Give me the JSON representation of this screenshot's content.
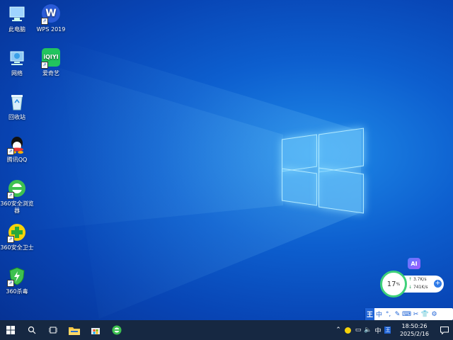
{
  "desktop": {
    "icons": [
      {
        "label": "此电脑",
        "icon": "computer-icon"
      },
      {
        "label": "WPS 2019",
        "icon": "wps-icon"
      },
      {
        "label": "网络",
        "icon": "network-icon"
      },
      {
        "label": "爱奇艺",
        "icon": "iqiyi-icon"
      },
      {
        "label": "回收站",
        "icon": "recycle-bin-icon"
      },
      {
        "label": "腾讯QQ",
        "icon": "qq-icon"
      },
      {
        "label": "360安全浏览器",
        "icon": "360-browser-icon"
      },
      {
        "label": "360安全卫士",
        "icon": "360-guard-icon"
      },
      {
        "label": "360杀毒",
        "icon": "360-antivirus-icon"
      }
    ],
    "iqiyi_logo_text": "iQIYI",
    "wps_logo_text": "W"
  },
  "widget": {
    "ai_label": "AI",
    "cpu_percent": "17",
    "percent_sign": "%",
    "upload": "3.7K/s",
    "download": "741K/s"
  },
  "ime": {
    "items": [
      "王",
      "中",
      "°,",
      "✎",
      "⌨",
      "✂",
      "👕",
      "⚙"
    ]
  },
  "taskbar": {
    "clock_time": "18:50:26",
    "clock_date": "2025/2/16",
    "tray_ime": "中",
    "tray_wubi": "王"
  },
  "colors": {
    "taskbar": "#162842",
    "accent": "#1e63d6",
    "speed_ring": "#3fd17a"
  }
}
